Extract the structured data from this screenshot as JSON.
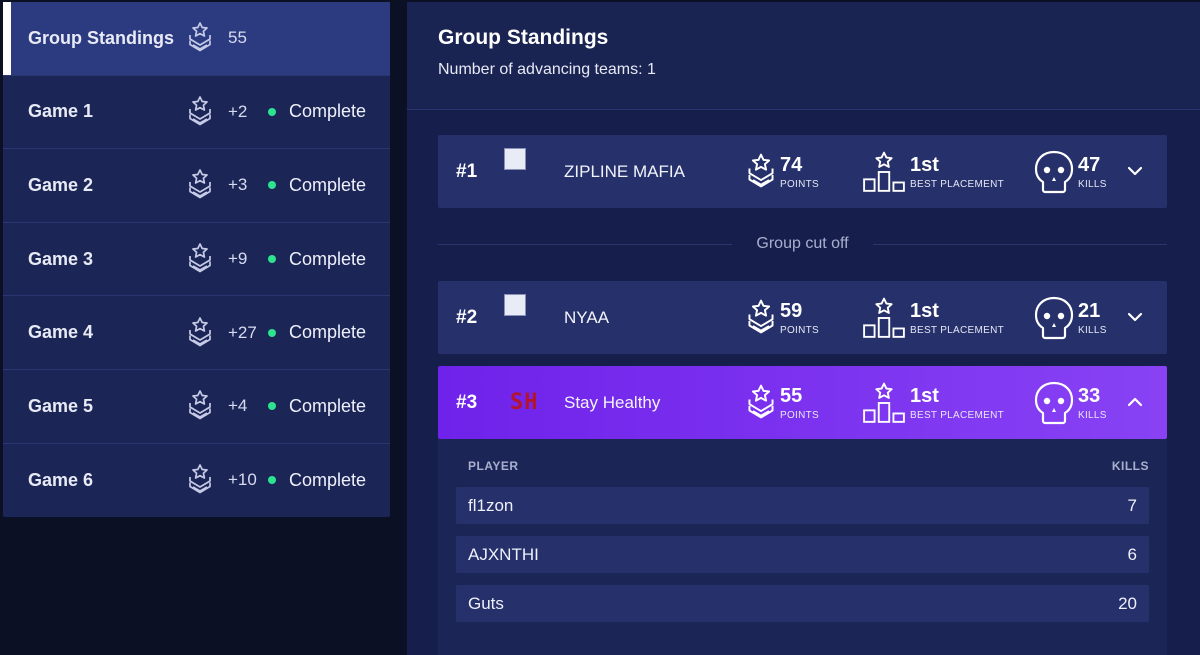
{
  "sidebar": {
    "items": [
      {
        "label": "Group Standings",
        "points": "55",
        "status": ""
      },
      {
        "label": "Game 1",
        "points": "+2",
        "status": "Complete"
      },
      {
        "label": "Game 2",
        "points": "+3",
        "status": "Complete"
      },
      {
        "label": "Game 3",
        "points": "+9",
        "status": "Complete"
      },
      {
        "label": "Game 4",
        "points": "+27",
        "status": "Complete"
      },
      {
        "label": "Game 5",
        "points": "+4",
        "status": "Complete"
      },
      {
        "label": "Game 6",
        "points": "+10",
        "status": "Complete"
      }
    ]
  },
  "main": {
    "title": "Group Standings",
    "subtitle": "Number of advancing teams: 1",
    "cutoff_label": "Group cut off",
    "stat_labels": {
      "points": "POINTS",
      "placement": "BEST PLACEMENT",
      "kills": "KILLS"
    },
    "teams": [
      {
        "rank": "#1",
        "name": "ZIPLINE MAFIA",
        "points": "74",
        "best_placement": "1st",
        "kills": "47",
        "logo": "broken-image"
      },
      {
        "rank": "#2",
        "name": "NYAA",
        "points": "59",
        "best_placement": "1st",
        "kills": "21",
        "logo": "broken-image"
      },
      {
        "rank": "#3",
        "name": "Stay Healthy",
        "points": "55",
        "best_placement": "1st",
        "kills": "33",
        "logo": "SH"
      }
    ],
    "players_table": {
      "header_player": "PLAYER",
      "header_kills": "KILLS",
      "rows": [
        {
          "player": "fl1zon",
          "kills": "7"
        },
        {
          "player": "AJXNTHI",
          "kills": "6"
        },
        {
          "player": "Guts",
          "kills": "20"
        }
      ]
    }
  },
  "colors": {
    "background": "#0b1024",
    "sidebar": "#1c2656",
    "active_row": "#2c3a80",
    "expanded_team_gradient": [
      "#6f22ea",
      "#8842f4"
    ],
    "status_dot": "#2ee38f",
    "logo_red": "#b3142e"
  },
  "icons": [
    "rank-chevron-star-icon",
    "podium-icon",
    "skull-icon",
    "chevron-down-icon",
    "chevron-up-icon",
    "broken-image-icon"
  ]
}
